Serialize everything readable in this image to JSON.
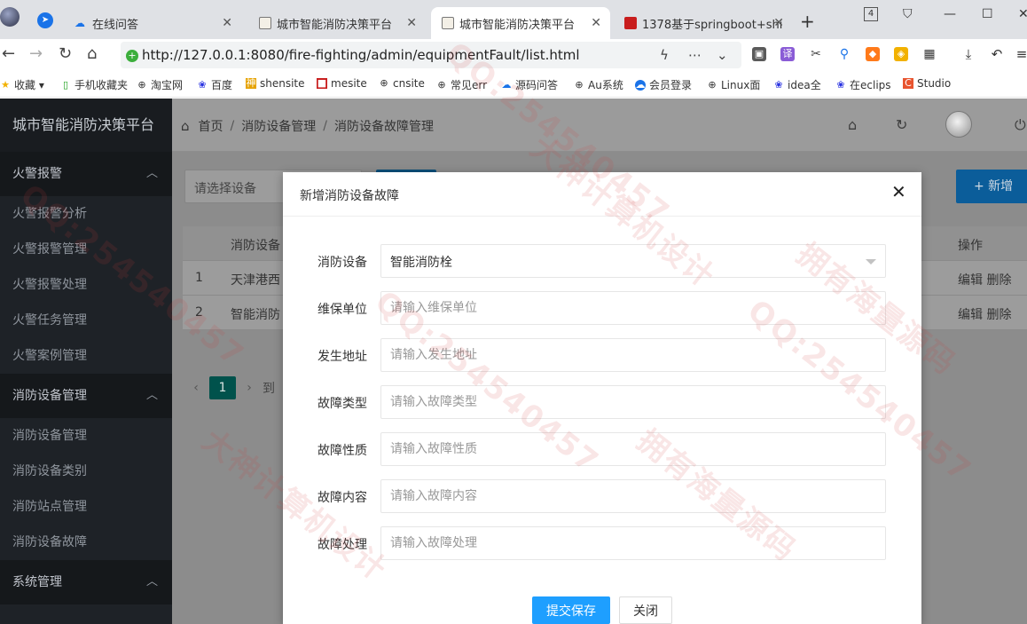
{
  "browser": {
    "tabs": [
      {
        "title": "在线问答",
        "active": false
      },
      {
        "title": "城市智能消防决策平台",
        "active": false
      },
      {
        "title": "城市智能消防决策平台",
        "active": true
      },
      {
        "title": "1378基于springboot+shi",
        "active": false
      }
    ],
    "badge_count": "4",
    "url": "http://127.0.0.1:8080/fire-fighting/admin/equipmentFault/list.html",
    "bookmarks": [
      "收藏",
      "手机收藏夹",
      "淘宝网",
      "百度",
      "shensite",
      "mesite",
      "cnsite",
      "常见err",
      "源码问答",
      "Au系统",
      "会员登录",
      "Linux面",
      "idea全",
      "在eclips",
      "Studio"
    ]
  },
  "app": {
    "title": "城市智能消防决策平台",
    "sidebar": [
      {
        "group": "火警报警",
        "items": [
          "火警报警分析",
          "火警报警管理",
          "火警报警处理",
          "火警任务管理",
          "火警案例管理"
        ]
      },
      {
        "group": "消防设备管理",
        "items": [
          "消防设备管理",
          "消防设备类别",
          "消防站点管理",
          "消防设备故障"
        ]
      },
      {
        "group": "系统管理",
        "items": []
      }
    ],
    "breadcrumb": [
      "首页",
      "消防设备管理",
      "消防设备故障管理"
    ],
    "breadcrumb_sep": "/"
  },
  "list": {
    "select_placeholder": "请选择设备",
    "add_label": "+ 新增",
    "header": {
      "device": "消防设备",
      "action": "操作"
    },
    "rows": [
      {
        "index": "1",
        "device": "天津港西",
        "actions": "编辑 删除"
      },
      {
        "index": "2",
        "device": "智能消防",
        "actions": "编辑 删除"
      }
    ],
    "pager": {
      "current": "1",
      "next_text": "到"
    }
  },
  "modal": {
    "title": "新增消防设备故障",
    "fields": [
      {
        "label": "消防设备",
        "type": "select",
        "value": "智能消防栓"
      },
      {
        "label": "维保单位",
        "placeholder": "请输入维保单位"
      },
      {
        "label": "发生地址",
        "placeholder": "请输入发生地址"
      },
      {
        "label": "故障类型",
        "placeholder": "请输入故障类型"
      },
      {
        "label": "故障性质",
        "placeholder": "请输入故障性质"
      },
      {
        "label": "故障内容",
        "placeholder": "请输入故障内容"
      },
      {
        "label": "故障处理",
        "placeholder": "请输入故障处理"
      }
    ],
    "submit_label": "提交保存",
    "cancel_label": "关闭"
  },
  "watermarks": [
    "QQ:254540457",
    "大神计算机设计",
    "拥有海量源码"
  ],
  "colors": {
    "sidebar_bg": "#1e2227",
    "primary_button": "#1e9fff",
    "pager_active": "#00524c",
    "watermark": "#d23c3c"
  }
}
